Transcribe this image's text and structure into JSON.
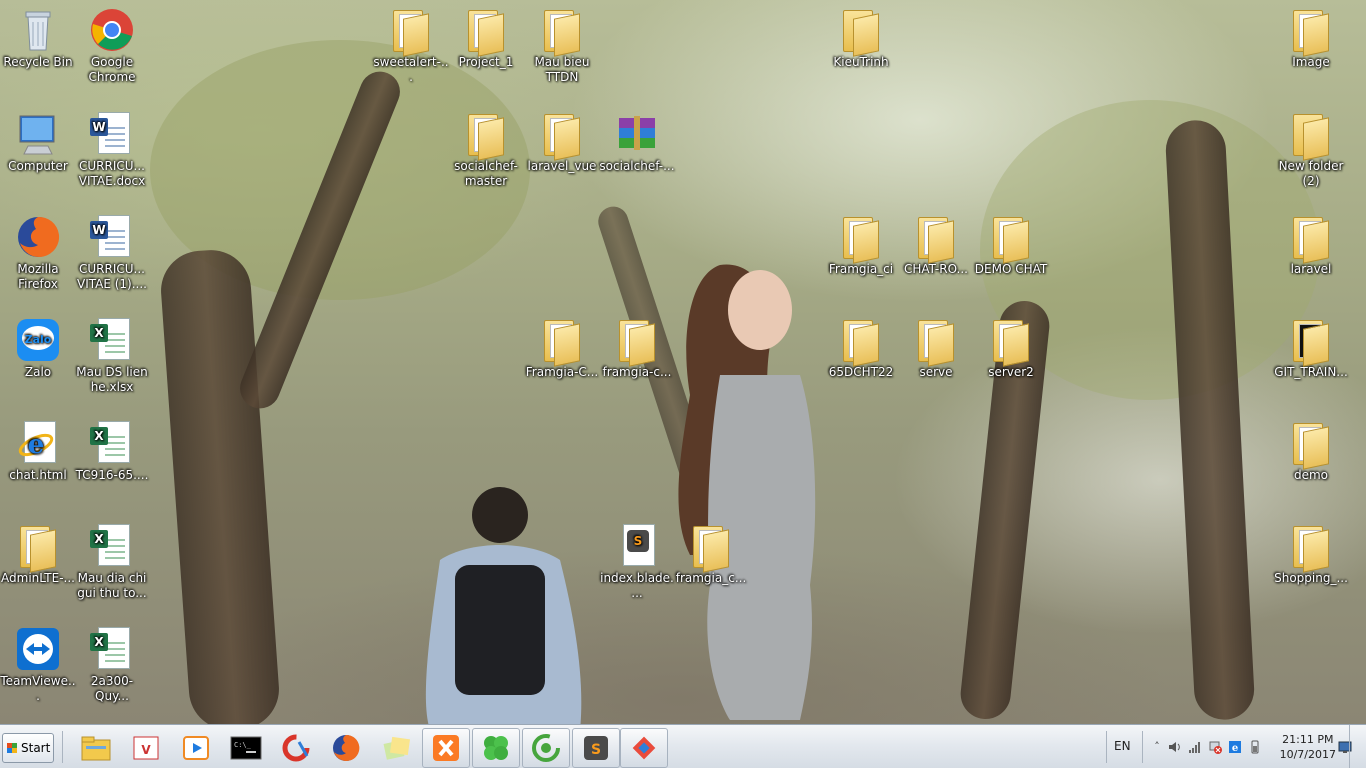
{
  "desktop": {
    "icons": [
      {
        "label": "Recycle Bin",
        "kind": "recycle-bin-icon"
      },
      {
        "label": "Google Chrome",
        "kind": "chrome-icon"
      },
      {
        "label": "sweetalert-...",
        "kind": "folder-icon"
      },
      {
        "label": "Project_1",
        "kind": "folder-icon"
      },
      {
        "label": "Mau bieu TTDN",
        "kind": "folder-icon"
      },
      {
        "label": "KieuTrinh",
        "kind": "folder-icon"
      },
      {
        "label": "Image",
        "kind": "folder-icon"
      },
      {
        "label": "Computer",
        "kind": "computer-icon"
      },
      {
        "label": "CURRICU... VITAE.docx",
        "kind": "word-doc-icon"
      },
      {
        "label": "socialchef-master",
        "kind": "folder-icon"
      },
      {
        "label": "laravel_vue",
        "kind": "folder-icon"
      },
      {
        "label": "socialchef-...",
        "kind": "winrar-archive-icon"
      },
      {
        "label": "New folder (2)",
        "kind": "folder-icon"
      },
      {
        "label": "Mozilla Firefox",
        "kind": "firefox-icon"
      },
      {
        "label": "CURRICU... VITAE (1)....",
        "kind": "word-doc-icon"
      },
      {
        "label": "Framgia_ci",
        "kind": "folder-icon"
      },
      {
        "label": "CHAT-RO...",
        "kind": "folder-icon"
      },
      {
        "label": "DEMO CHAT",
        "kind": "folder-icon"
      },
      {
        "label": "laravel",
        "kind": "folder-icon"
      },
      {
        "label": "Zalo",
        "kind": "zalo-icon"
      },
      {
        "label": "Mau DS lien he.xlsx",
        "kind": "excel-doc-icon"
      },
      {
        "label": "Framgia-C...",
        "kind": "folder-icon"
      },
      {
        "label": "framgia-c...",
        "kind": "folder-icon"
      },
      {
        "label": "65DCHT22",
        "kind": "folder-icon"
      },
      {
        "label": "serve",
        "kind": "folder-icon"
      },
      {
        "label": "server2",
        "kind": "folder-icon"
      },
      {
        "label": "GIT_TRAIN...",
        "kind": "folder-icon"
      },
      {
        "label": "chat.html",
        "kind": "internet-explorer-icon"
      },
      {
        "label": "TC916-65....",
        "kind": "excel-doc-icon"
      },
      {
        "label": "demo",
        "kind": "folder-icon"
      },
      {
        "label": "AdminLTE-...",
        "kind": "folder-icon"
      },
      {
        "label": "Mau dia chi gui thu to...",
        "kind": "excel-doc-icon"
      },
      {
        "label": "index.blade....",
        "kind": "sublime-file-icon"
      },
      {
        "label": "framgia_c...",
        "kind": "folder-icon"
      },
      {
        "label": "Shopping_...",
        "kind": "folder-icon"
      },
      {
        "label": "TeamViewe...",
        "kind": "teamviewer-icon"
      },
      {
        "label": "2a300-Quy...",
        "kind": "excel-doc-icon"
      }
    ]
  },
  "taskbar": {
    "start_label": "Start",
    "pinned": [
      {
        "name": "windows-explorer-icon"
      },
      {
        "name": "unikey-icon"
      },
      {
        "name": "media-player-icon"
      },
      {
        "name": "command-prompt-icon"
      },
      {
        "name": "ccleaner-icon"
      },
      {
        "name": "firefox-icon"
      },
      {
        "name": "sticky-notes-icon"
      },
      {
        "name": "xampp-icon"
      },
      {
        "name": "clover-icon"
      },
      {
        "name": "coc-coc-icon"
      },
      {
        "name": "sublime-text-icon"
      },
      {
        "name": "git-icon"
      }
    ],
    "tray": {
      "language": "EN",
      "time": "21:11 PM",
      "date": "10/7/2017"
    }
  },
  "colors": {
    "folder_yellow": "#e9c05a",
    "word_blue": "#2b579a",
    "excel_green": "#217346",
    "taskbar_bg": "#e3e8ee"
  }
}
